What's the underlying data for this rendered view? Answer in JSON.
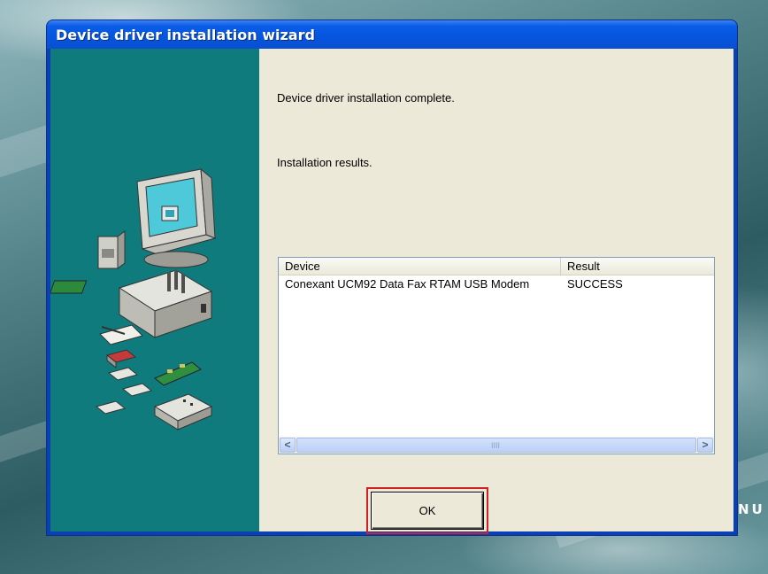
{
  "desktop": {
    "text": "NU"
  },
  "window": {
    "title": "Device driver installation wizard",
    "message": "Device driver installation complete.",
    "results_label": "Installation results."
  },
  "results_list": {
    "columns": [
      "Device",
      "Result"
    ],
    "rows": [
      {
        "device": "Conexant UCM92 Data Fax RTAM USB Modem",
        "result": "SUCCESS"
      }
    ],
    "scroll_left": "<",
    "scroll_right": ">",
    "scroll_grip": "IIII"
  },
  "buttons": {
    "ok": "OK"
  },
  "colors": {
    "title_bar": "#0555de",
    "left_panel": "#0f7b7d",
    "dialog_bg": "#ece9d8",
    "highlight": "#d0201f"
  }
}
